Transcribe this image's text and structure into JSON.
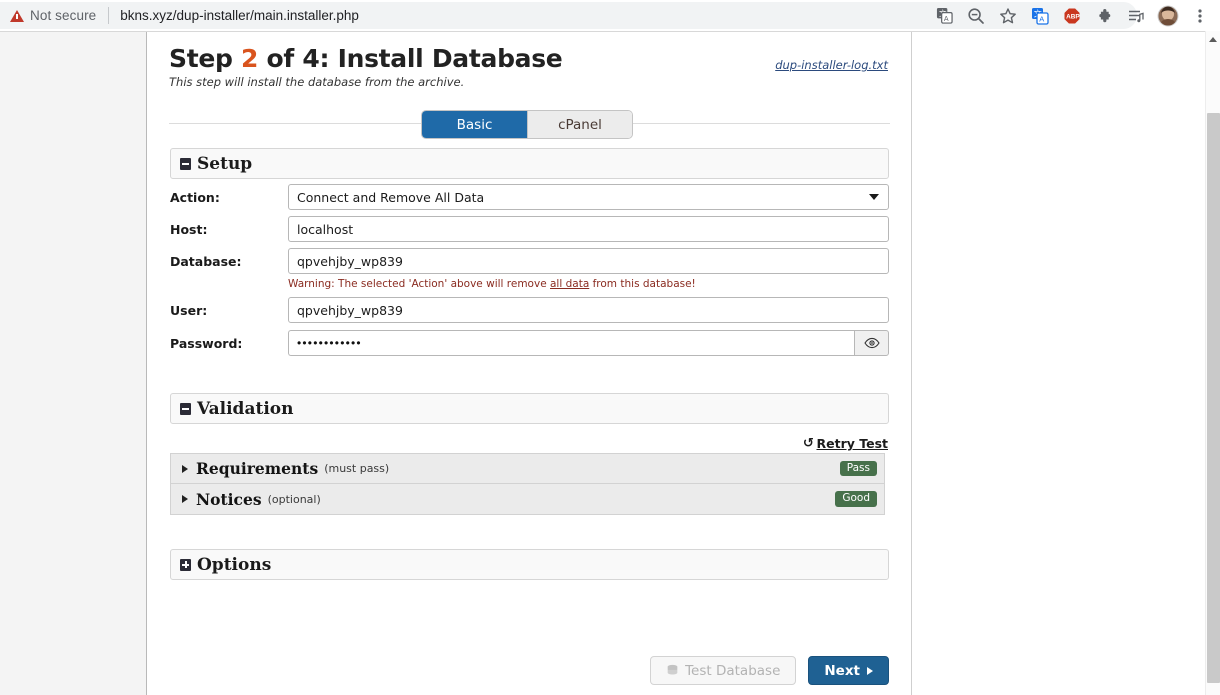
{
  "browser": {
    "security_label": "Not secure",
    "url": "bkns.xyz/dup-installer/main.installer.php",
    "toolbar_icons": [
      "translate-icon",
      "zoom-out-icon",
      "bookmark-star-icon",
      "google-translate-extension-icon",
      "adblock-plus-icon",
      "extensions-puzzle-icon",
      "media-playlist-icon",
      "profile-avatar-icon",
      "chrome-menu-icon"
    ]
  },
  "header": {
    "title_prefix": "Step ",
    "step_number": "2",
    "title_suffix": " of 4: Install Database",
    "subtitle": "This step will install the database from the archive.",
    "log_link": "dup-installer-log.txt"
  },
  "tabs": [
    {
      "label": "Basic",
      "active": true
    },
    {
      "label": "cPanel",
      "active": false
    }
  ],
  "setup": {
    "section_title": "Setup",
    "collapsed": false,
    "fields": {
      "action": {
        "label": "Action:",
        "value": "Connect and Remove All Data",
        "options": [
          "Connect and Remove All Data"
        ]
      },
      "host": {
        "label": "Host:",
        "value": "localhost",
        "placeholder": ""
      },
      "database": {
        "label": "Database:",
        "value": "qpvehjby_wp839",
        "placeholder": ""
      },
      "user": {
        "label": "User:",
        "value": "qpvehjby_wp839",
        "placeholder": ""
      },
      "password": {
        "label": "Password:",
        "value": "••••••••••••",
        "placeholder": ""
      }
    },
    "warning": {
      "before": "Warning: The selected 'Action' above will remove ",
      "emphasis": "all data",
      "after": " from this database!"
    }
  },
  "validation": {
    "section_title": "Validation",
    "collapsed": false,
    "retry_label": "Retry Test",
    "rows": [
      {
        "title": "Requirements",
        "note": "(must pass)",
        "badge": "Pass"
      },
      {
        "title": "Notices",
        "note": "(optional)",
        "badge": "Good"
      }
    ]
  },
  "options": {
    "section_title": "Options",
    "collapsed": true
  },
  "footer": {
    "test_button": "Test Database",
    "next_button": "Next"
  },
  "colors": {
    "tab_active": "#1f6aa8",
    "primary_button": "#1f6193",
    "badge_green": "#47714b",
    "step_number": "#d9541e",
    "warning_text": "#8a2b20",
    "link": "#2b4a7d"
  }
}
